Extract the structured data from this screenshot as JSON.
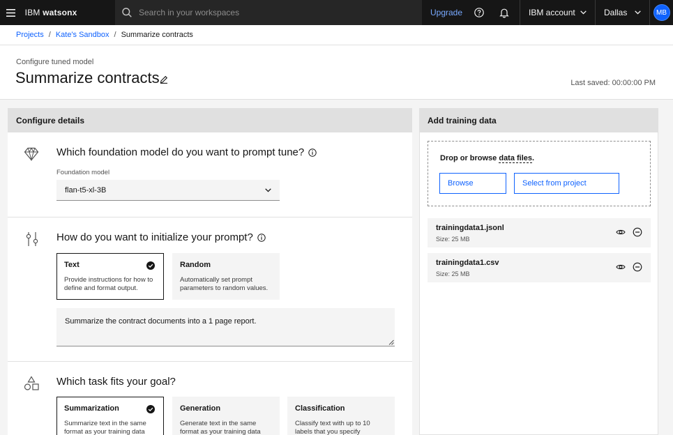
{
  "header": {
    "brand_prefix": "IBM",
    "brand_name": "watsonx",
    "search_placeholder": "Search in your workspaces",
    "upgrade_label": "Upgrade",
    "account_label": "IBM account",
    "region_label": "Dallas",
    "avatar_initials": "MB"
  },
  "breadcrumb": {
    "items": [
      "Projects",
      "Kate's Sandbox",
      "Summarize contracts"
    ],
    "separator": "/"
  },
  "page": {
    "eyebrow": "Configure tuned model",
    "title": "Summarize contracts",
    "last_saved": "Last saved: 00:00:00 PM"
  },
  "left_panel": {
    "title": "Configure details",
    "model_section": {
      "question": "Which foundation model do you want to prompt tune?",
      "field_label": "Foundation model",
      "selected_model": "flan-t5-xl-3B"
    },
    "init_section": {
      "question": "How do you want to initialize your prompt?",
      "tiles": [
        {
          "title": "Text",
          "desc": "Provide instructions for how to define and format output.",
          "selected": true
        },
        {
          "title": "Random",
          "desc": "Automatically set prompt parameters to random values.",
          "selected": false
        }
      ],
      "prompt_text": "Summarize the contract documents into a 1 page report."
    },
    "task_section": {
      "question": "Which task fits your goal?",
      "tiles": [
        {
          "title": "Summarization",
          "desc": "Summarize text in the same format as your training data",
          "selected": true
        },
        {
          "title": "Generation",
          "desc": "Generate text in the same format as your training data",
          "selected": false
        },
        {
          "title": "Classification",
          "desc": "Classify text with up to 10 labels that you specify",
          "selected": false
        }
      ]
    }
  },
  "right_panel": {
    "title": "Add training data",
    "drop_text_prefix": "Drop or browse ",
    "drop_text_link": "data files",
    "drop_text_suffix": ".",
    "browse_label": "Browse",
    "select_project_label": "Select from project",
    "files": [
      {
        "name": "trainingdata1.jsonl",
        "size": "Size: 25 MB"
      },
      {
        "name": "trainingdata1.csv",
        "size": "Size: 25 MB"
      }
    ]
  },
  "colors": {
    "header_bg": "#161616",
    "accent": "#0f62fe",
    "link": "#78a9ff"
  },
  "icons": [
    "menu-icon",
    "search-icon",
    "help-icon",
    "notification-icon",
    "chevron-down-icon",
    "edit-icon",
    "diamond-icon",
    "sliders-icon",
    "shapes-icon",
    "info-icon",
    "checkmark-filled-icon",
    "view-icon",
    "subtract-circle-icon",
    "resize-handle-icon"
  ]
}
